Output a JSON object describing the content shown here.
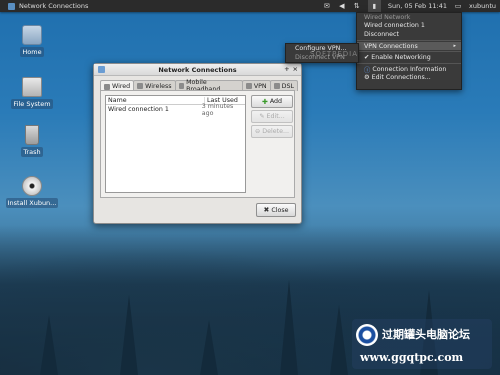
{
  "panel": {
    "window_button": "Network Connections",
    "datetime": "Sun, 05 Feb  11:41",
    "user": "xubuntu"
  },
  "desktop": {
    "icons": [
      {
        "label": "Home"
      },
      {
        "label": "File System"
      },
      {
        "label": "Trash"
      },
      {
        "label": "Install Xubun..."
      }
    ]
  },
  "nm_menu": {
    "section_header": "Wired Network",
    "connection": "Wired connection 1",
    "disconnect": "Disconnect",
    "vpn": "VPN Connections",
    "enable_networking": "Enable Networking",
    "connection_info": "Connection Information",
    "edit_connections": "Edit Connections...",
    "submenu": {
      "configure_vpn": "Configure VPN...",
      "disconnect_vpn": "Disconnect VPN"
    }
  },
  "window": {
    "title": "Network Connections",
    "tabs": [
      "Wired",
      "Wireless",
      "Mobile Broadband",
      "VPN",
      "DSL"
    ],
    "columns": {
      "name": "Name",
      "last_used": "Last Used"
    },
    "rows": [
      {
        "name": "Wired connection 1",
        "last_used": "3 minutes ago"
      }
    ],
    "buttons": {
      "add": "Add",
      "edit": "Edit...",
      "delete": "Delete..."
    },
    "close": "Close"
  },
  "watermark": {
    "softpedia": "SOFTPEDIA",
    "site_name": "过期罐头电脑论坛",
    "url": "www.ggqtpc.com"
  }
}
